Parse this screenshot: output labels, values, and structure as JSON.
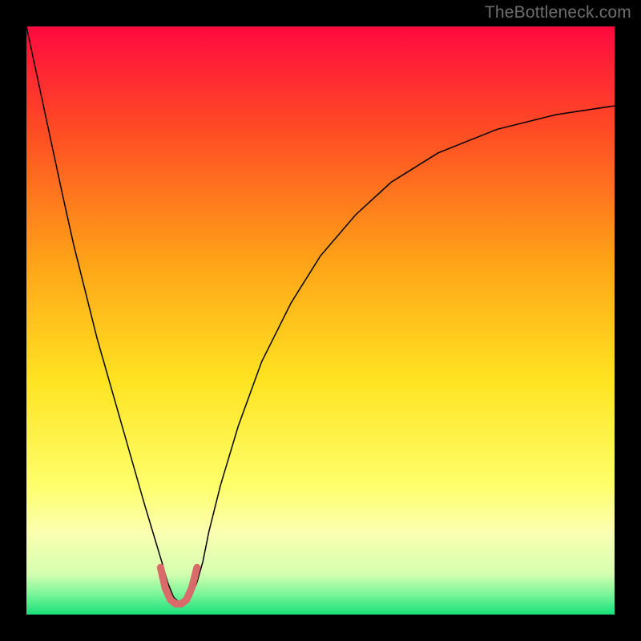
{
  "watermark": "TheBottleneck.com",
  "chart_data": {
    "type": "line",
    "title": "",
    "xlabel": "",
    "ylabel": "",
    "xlim": [
      0,
      100
    ],
    "ylim": [
      0,
      100
    ],
    "grid": false,
    "legend": false,
    "background_gradient": {
      "stops": [
        {
          "offset": 0.0,
          "color": "#ff0a3f"
        },
        {
          "offset": 0.18,
          "color": "#ff4d24"
        },
        {
          "offset": 0.4,
          "color": "#ffa318"
        },
        {
          "offset": 0.6,
          "color": "#ffe321"
        },
        {
          "offset": 0.78,
          "color": "#feff6a"
        },
        {
          "offset": 0.86,
          "color": "#fbffb0"
        },
        {
          "offset": 0.93,
          "color": "#d6ffb0"
        },
        {
          "offset": 0.965,
          "color": "#7cf59a"
        },
        {
          "offset": 1.0,
          "color": "#18e07a"
        }
      ]
    },
    "series": [
      {
        "name": "bottleneck-curve",
        "stroke": "#000000",
        "stroke_width": 1.5,
        "x": [
          0.0,
          1.5,
          3.0,
          4.5,
          6.0,
          8.0,
          10.0,
          12.0,
          14.0,
          16.0,
          18.0,
          20.0,
          21.5,
          23.0,
          24.0,
          25.0,
          26.0,
          27.0,
          28.0,
          29.0,
          30.0,
          31.0,
          33.0,
          36.0,
          40.0,
          45.0,
          50.0,
          56.0,
          62.0,
          70.0,
          80.0,
          90.0,
          100.0
        ],
        "y": [
          100.0,
          93.0,
          86.0,
          79.0,
          72.0,
          63.0,
          55.0,
          47.0,
          40.0,
          33.0,
          26.0,
          19.0,
          14.0,
          9.0,
          5.5,
          3.0,
          2.0,
          2.0,
          3.0,
          5.5,
          9.0,
          14.0,
          22.0,
          32.0,
          43.0,
          53.0,
          61.0,
          68.0,
          73.5,
          78.5,
          82.5,
          85.0,
          86.5
        ]
      },
      {
        "name": "highlight-valley",
        "stroke": "#d96b6b",
        "stroke_width": 9,
        "linecap": "round",
        "x": [
          22.8,
          23.6,
          24.5,
          25.4,
          26.3,
          27.2,
          28.1,
          29.0
        ],
        "y": [
          8.0,
          4.5,
          2.5,
          1.8,
          1.8,
          2.5,
          4.5,
          8.0
        ]
      }
    ]
  }
}
